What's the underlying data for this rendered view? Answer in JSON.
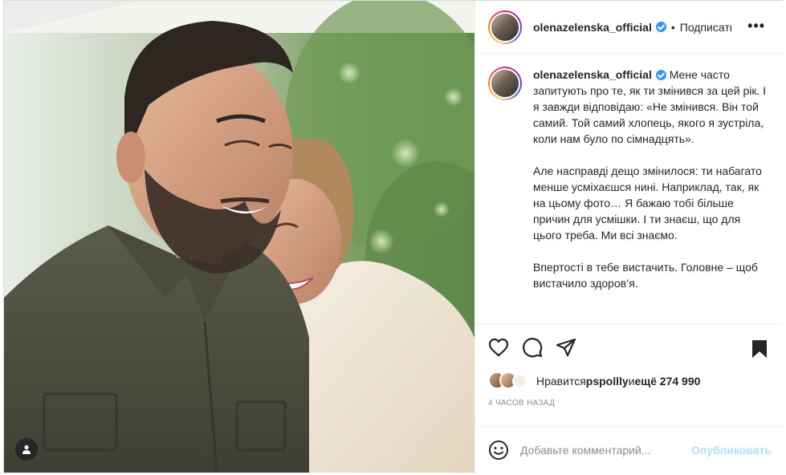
{
  "post": {
    "username": "olenazelenska_official",
    "follow_label": "Подписаться",
    "separator": "•",
    "more_label": "•••",
    "photo_alt": "",
    "caption_paragraphs": [
      "Мене часто запитують про те, як ти змінився за цей рік. І я завжди відповідаю: «Не змінився. Він той самий. Той самий хлопець, якого я зустріла, коли нам було по сімнадцять».",
      "Але насправді дещо змінилося: ти набагато менше усміхаєшся нині. Наприклад, так, як на цьому фото… Я бажаю тобі більше причин для усмішки. І ти знаєш, що для цього треба. Ми всі знаємо.",
      "Впертості в тебе вистачить. Головне – щоб вистачило здоров’я."
    ],
    "likes": {
      "prefix": "Нравится ",
      "user": "pspollly",
      "middle": " и ",
      "rest": "ещё 274 990"
    },
    "time_ago": "4 часов назад",
    "comment": {
      "placeholder": "Добавьте комментарий...",
      "publish_label": "Опубликовать"
    }
  },
  "icons": {
    "like": "heart-icon",
    "comment": "comment-icon",
    "share": "share-icon",
    "save": "bookmark-icon",
    "emoji": "emoji-icon",
    "tag": "user-tag-icon"
  },
  "colors": {
    "verified": "#3897f0",
    "publish_disabled": "#b2dffc",
    "muted_text": "#8e8e8e"
  }
}
